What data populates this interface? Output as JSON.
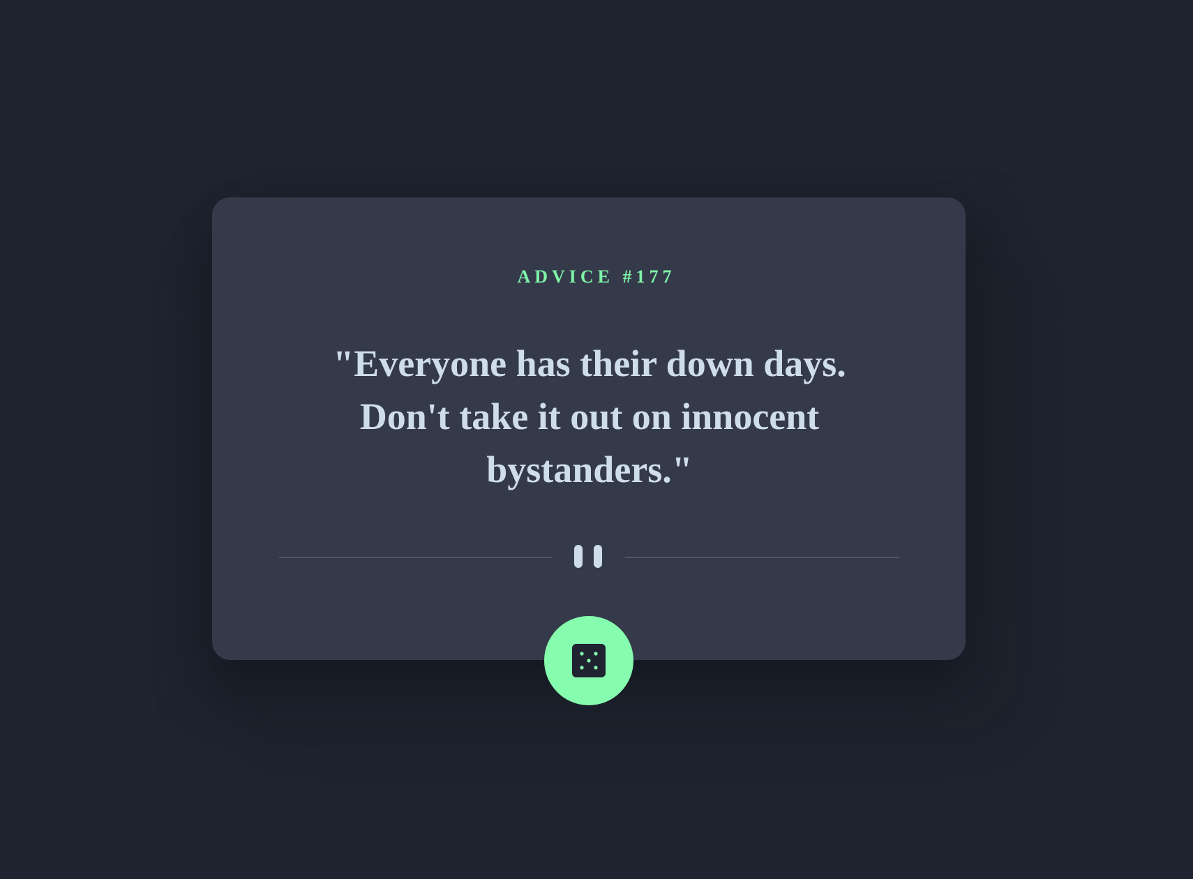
{
  "advice": {
    "label": "ADVICE #177",
    "quote": "\"Everyone has their down days. Don't take it out on innocent bystanders.\""
  },
  "divider": {
    "icon": "pause-icon"
  },
  "action": {
    "icon": "dice-icon"
  },
  "colors": {
    "background": "#1f2430",
    "card": "#353a4a",
    "accent": "#86fcaf",
    "text": "#cfdde9",
    "divider": "#4e5569"
  }
}
